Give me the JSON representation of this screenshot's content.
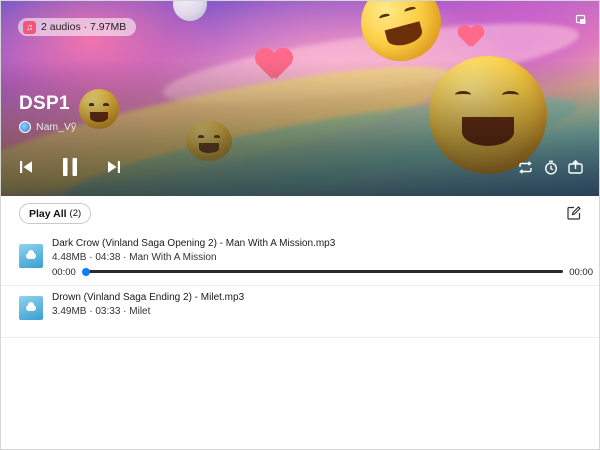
{
  "header": {
    "chip_label": "2 audios · 7.97MB",
    "chip_icon": "music-note-icon",
    "title": "DSP1",
    "artist": "Nam_Vỹ"
  },
  "controls": {
    "previous_icon": "skip-previous-icon",
    "pause_icon": "pause-icon",
    "next_icon": "skip-next-icon",
    "repeat_icon": "repeat-icon",
    "timer_icon": "timer-icon",
    "export_icon": "export-icon"
  },
  "toolbar": {
    "play_all_label": "Play All",
    "play_all_count": "(2)",
    "edit_icon": "edit-icon"
  },
  "tracks": [
    {
      "name": "Dark Crow (Vinland Saga Opening 2) - Man With A Mission.mp3",
      "meta": "4.48MB · 04:38 · Man With A Mission",
      "current_time": "00:00",
      "end_time": "00:00",
      "progress": 0
    },
    {
      "name": "Drown (Vinland Saga Ending 2) - Milet.mp3",
      "meta": "3.49MB · 03:33 · Milet"
    }
  ],
  "colors": {
    "accent": "#1677ff",
    "chip_icon_bg": "#f0577a"
  }
}
